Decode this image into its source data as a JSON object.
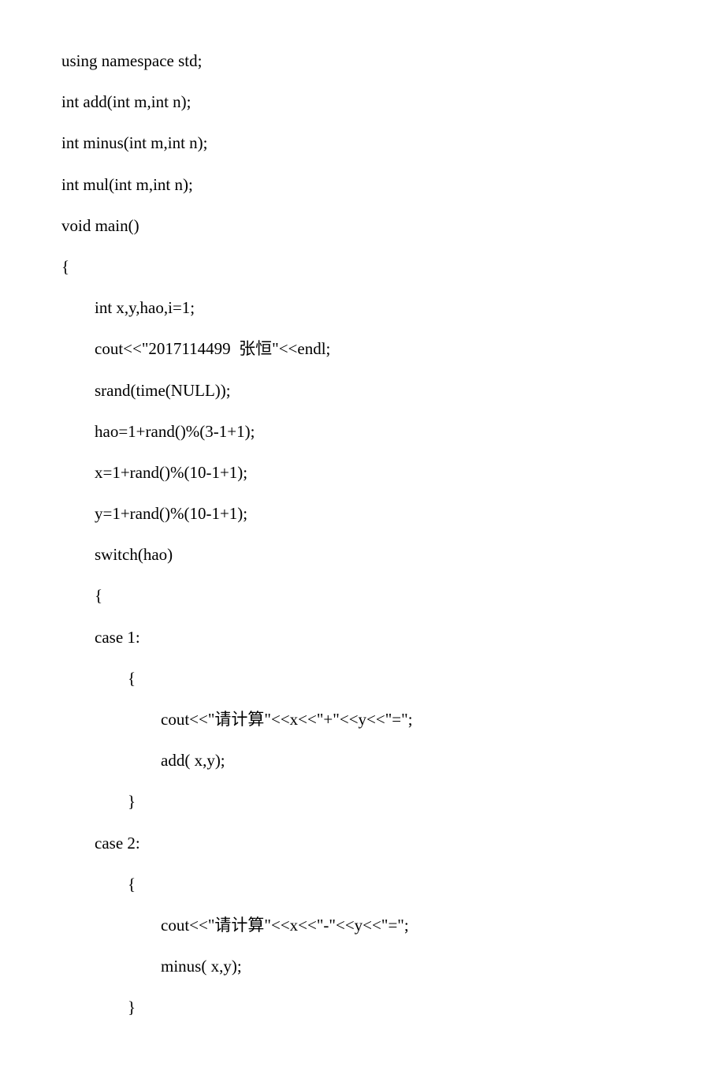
{
  "code": {
    "l1": "using namespace std;",
    "l2": "int add(int m,int n);",
    "l3": "int minus(int m,int n);",
    "l4": "int mul(int m,int n);",
    "l5": "void main()",
    "l6": "{",
    "l7": "int x,y,hao,i=1;",
    "l8": "cout<<\"2017114499  张恒\"<<endl;",
    "l9": "srand(time(NULL));",
    "l10": "hao=1+rand()%(3-1+1);",
    "l11": "x=1+rand()%(10-1+1);",
    "l12": "y=1+rand()%(10-1+1);",
    "l13": "switch(hao)",
    "l14": "{",
    "l15": "case 1:",
    "l16": "{",
    "l17": "cout<<\"请计算\"<<x<<\"+\"<<y<<\"=\";",
    "l18": "add( x,y);",
    "l19": "}",
    "l20": "case 2:",
    "l21": "{",
    "l22": "cout<<\"请计算\"<<x<<\"-\"<<y<<\"=\";",
    "l23": "minus( x,y);",
    "l24": "}"
  }
}
